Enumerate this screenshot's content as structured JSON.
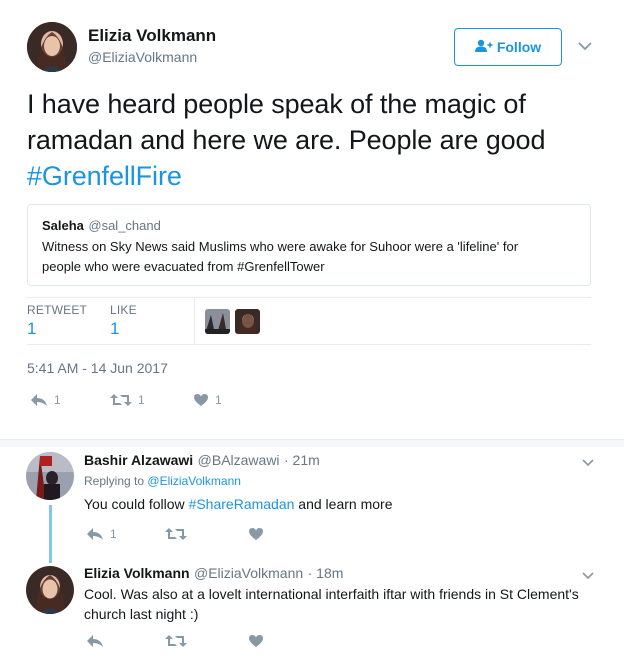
{
  "tweet": {
    "author_name": "Elizia Volkmann",
    "author_handle": "@EliziaVolkmann",
    "follow_label": "Follow",
    "text_line1": "I have heard people speak of the magic of",
    "text_line2": "ramadan and here we are. People are good",
    "hashtag": "#GrenfellFire",
    "quote": {
      "name": "Saleha",
      "handle": "@sal_chand",
      "text_line1": "Witness on Sky News said Muslims who were awake for Suhoor were a 'lifeline' for",
      "text_line2": "people who were evacuated from #GrenfellTower"
    },
    "stats": {
      "retweet_label": "RETWEET",
      "retweet_count": "1",
      "like_label": "LIKE",
      "like_count": "1"
    },
    "timestamp": "5:41 AM - 14 Jun 2017",
    "actions": {
      "reply_count": "1",
      "retweet_count": "1",
      "like_count": "1"
    }
  },
  "replies": [
    {
      "name": "Bashir Alzawawi",
      "handle": "@BAlzawawi",
      "time": "· 21m",
      "replying_prefix": "Replying to",
      "replying_to": "@EliziaVolkmann",
      "text_before": "You could follow ",
      "hashtag": "#ShareRamadan",
      "text_after": " and learn more",
      "reply_count": "1"
    },
    {
      "name": "Elizia Volkmann",
      "handle": "@EliziaVolkmann",
      "time": "· 18m",
      "text_line1": "Cool.  Was also at a lovelt international interfaith iftar with friends in St Clement's",
      "text_line2": "church last night :)"
    }
  ],
  "colors": {
    "accent": "#1b95e0",
    "muted": "#657786",
    "icon": "#8899a6"
  },
  "icons": [
    "follow-person-icon",
    "chevron-down-icon",
    "reply-icon",
    "retweet-icon",
    "heart-icon"
  ]
}
